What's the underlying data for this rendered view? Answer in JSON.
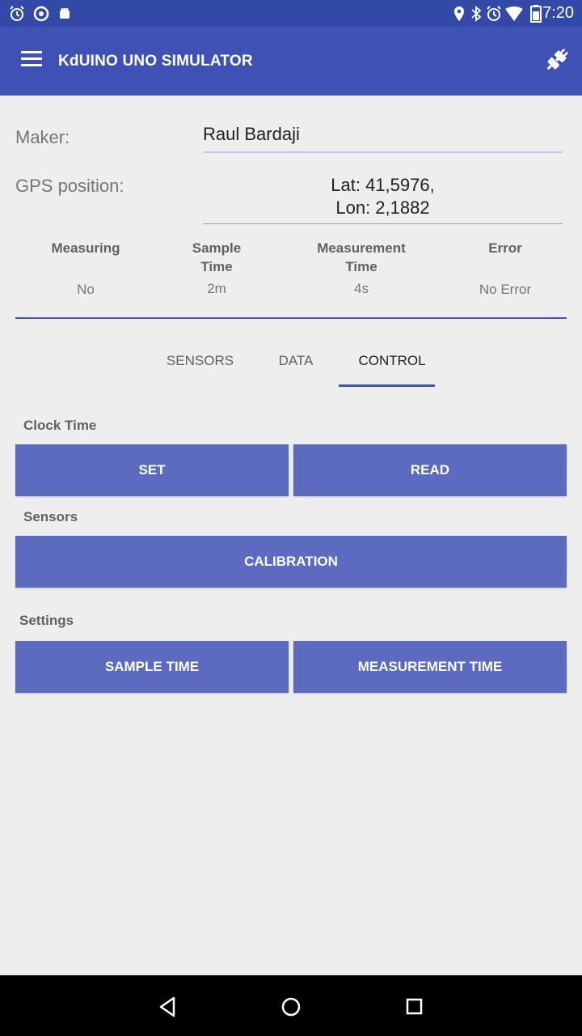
{
  "status_bar": {
    "time": "7:20",
    "left_icons": [
      "alarm-icon",
      "camera-icon",
      "android-icon"
    ],
    "right_icons": [
      "location-icon",
      "bluetooth-icon",
      "alarm-icon",
      "wifi-icon",
      "battery-icon"
    ]
  },
  "app_bar": {
    "title": "KdUINO UNO SIMULATOR",
    "bg_color": "#3f51b5"
  },
  "form": {
    "maker_label": "Maker:",
    "maker_value": "Raul Bardaji",
    "gps_label": "GPS position:",
    "gps_lat": "Lat: 41,5976,",
    "gps_lon": "Lon: 2,1882"
  },
  "stats": {
    "measuring": {
      "head1": "Measuring",
      "head2": "",
      "value": "No"
    },
    "sample_time": {
      "head1": "Sample",
      "head2": "Time",
      "value": "2m"
    },
    "measurement_time": {
      "head1": "Measurement",
      "head2": "Time",
      "value": "4s"
    },
    "error": {
      "head1": "Error",
      "head2": "",
      "value": "No Error"
    }
  },
  "tabs": [
    {
      "label": "SENSORS"
    },
    {
      "label": "DATA"
    },
    {
      "label": "CONTROL"
    }
  ],
  "active_tab": "CONTROL",
  "control": {
    "clock_label": "Clock Time",
    "set_label": "SET",
    "read_label": "READ",
    "sensors_label": "Sensors",
    "calibration_label": "CALIBRATION",
    "settings_label": "Settings",
    "sample_time_label": "SAMPLE TIME",
    "measurement_time_label": "MEASUREMENT TIME",
    "button_color": "#5c6bc0"
  }
}
